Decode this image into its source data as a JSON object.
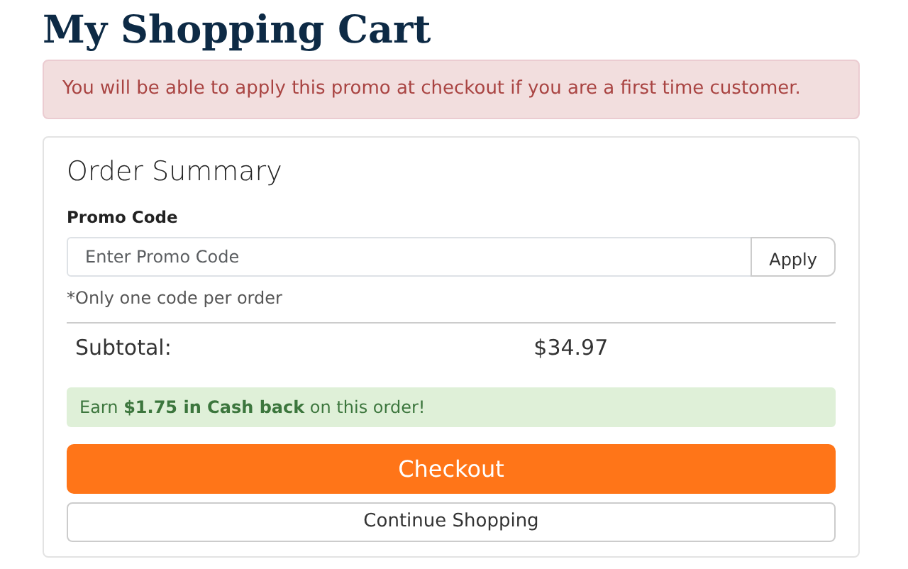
{
  "page_title": "My Shopping Cart",
  "notice": "You will be able to apply this promo at checkout if you are a first time customer.",
  "order_summary": {
    "title": "Order Summary",
    "promo": {
      "label": "Promo Code",
      "placeholder": "Enter Promo Code",
      "button": "Apply",
      "note": "*Only one code per order"
    },
    "subtotal": {
      "label": "Subtotal:",
      "value": "$34.97"
    },
    "cashback": "Earn **$1.75 in Cash back** on this order!",
    "buttons": [
      {
        "label": "Checkout",
        "kind": "primary"
      },
      {
        "label": "Continue Shopping",
        "kind": "secondary"
      }
    ]
  }
}
